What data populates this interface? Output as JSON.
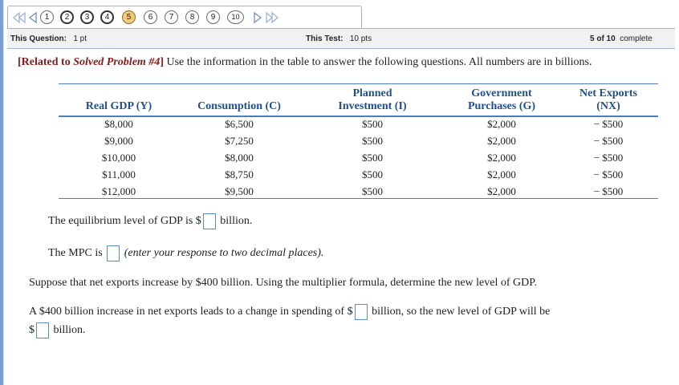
{
  "nav": {
    "pages": [
      "1",
      "2",
      "3",
      "4",
      "5",
      "6",
      "7",
      "8",
      "9",
      "10"
    ],
    "current": "5"
  },
  "info": {
    "question_label": "This Question:",
    "question_value": "1 pt",
    "test_label": "This Test:",
    "test_value": "10 pts",
    "progress_bold": "5 of 10",
    "progress_rest": "complete"
  },
  "intro": {
    "ref_open": "[Related to ",
    "ref_italic": "Solved Problem #4",
    "ref_close": "]",
    "text": "Use the information in the table to answer the following questions. All numbers are in billions."
  },
  "table": {
    "headers": [
      [
        "",
        "Real GDP (Y)"
      ],
      [
        "",
        "Consumption (C)"
      ],
      [
        "Planned",
        "Investment (I)"
      ],
      [
        "Government",
        "Purchases (G)"
      ],
      [
        "Net Exports",
        "(NX)"
      ]
    ],
    "rows": [
      [
        "$8,000",
        "$6,500",
        "$500",
        "$2,000",
        "− $500"
      ],
      [
        "$9,000",
        "$7,250",
        "$500",
        "$2,000",
        "− $500"
      ],
      [
        "$10,000",
        "$8,000",
        "$500",
        "$2,000",
        "− $500"
      ],
      [
        "$11,000",
        "$8,750",
        "$500",
        "$2,000",
        "− $500"
      ],
      [
        "$12,000",
        "$9,500",
        "$500",
        "$2,000",
        "− $500"
      ]
    ]
  },
  "questions": {
    "q1_before": "The equilibrium level of GDP is $",
    "q1_after": "billion.",
    "q2_before": "The MPC is",
    "q2_hint": "(enter your response to two decimal places).",
    "q3": "Suppose that net exports increase by $400 billion.  Using the multiplier formula, determine the new level of GDP.",
    "q4_before": "A $400 billion increase in net exports leads to a change in spending of $",
    "q4_after": "billion, so the new level of GDP will be",
    "q5_before": "$",
    "q5_after": "billion."
  }
}
